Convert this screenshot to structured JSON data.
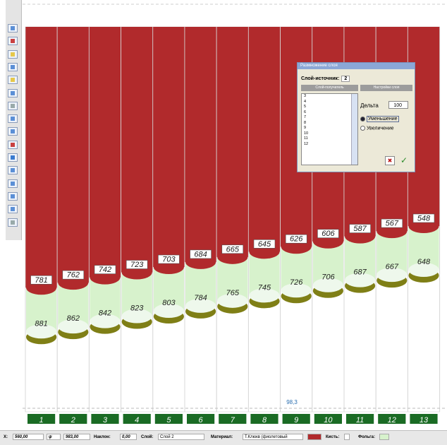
{
  "chart_data": {
    "type": "bar",
    "categories": [
      "1",
      "2",
      "3",
      "4",
      "5",
      "6",
      "7",
      "8",
      "9",
      "10",
      "11",
      "12",
      "13"
    ],
    "top_values": [
      781,
      762,
      742,
      723,
      703,
      684,
      665,
      645,
      626,
      606,
      587,
      567,
      548
    ],
    "bottom_values": [
      881,
      862,
      842,
      823,
      803,
      784,
      765,
      745,
      726,
      706,
      687,
      667,
      648
    ],
    "title": "",
    "xlabel": "",
    "ylabel": ""
  },
  "annotation": "98,3",
  "colors": {
    "fill_red": "#b12a2c",
    "band_green": "#d7f2cc",
    "olive": "#7f7f16",
    "header_green": "#1a6b24"
  },
  "dialog": {
    "title": "Размножение слоя",
    "source_label": "Слой-источник:",
    "source_value": "2",
    "tab_left": "Слой-получатель",
    "tab_right": "Настройки слоя",
    "list_items": [
      "3",
      "4",
      "5",
      "6",
      "7",
      "8",
      "9",
      "10",
      "11",
      "12"
    ],
    "delta_label": "Дельта",
    "delta_value": "100",
    "radio_decrease": "Уменьшение",
    "radio_increase": "Увеличение"
  },
  "status": {
    "x_label": "X:",
    "x_value": "560,00",
    "y_value": "983,00",
    "step_label": "Наклон:",
    "step_value": "0,00",
    "layer_label": "Слой:",
    "layer_value": "Слой 2",
    "material_label": "Материал:",
    "material_value": "Т.Клюкв (фиолетовый",
    "brush_label": "Кисть:",
    "bg_label": "Фольга:"
  },
  "toolbar_icons": [
    "pencil-icon",
    "eraser-icon",
    "fill-icon",
    "select-icon",
    "line-icon",
    "rect-icon",
    "text-icon",
    "zoom-icon",
    "move-icon",
    "delete-icon",
    "refresh-icon",
    "layer-icon",
    "align-icon",
    "step-icon",
    "grid-icon",
    "settings-icon"
  ]
}
